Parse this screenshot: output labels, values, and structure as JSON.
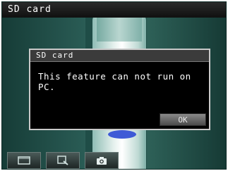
{
  "app": {
    "title": "SD card"
  },
  "dialog": {
    "title": "SD card",
    "message": "This feature can not run on\nPC.",
    "ok_label": "OK"
  },
  "toolbar": {
    "buttons": [
      {
        "icon": "frame-icon"
      },
      {
        "icon": "zoom-icon"
      },
      {
        "icon": "camera-icon"
      }
    ]
  },
  "colors": {
    "background": "#1f4d47",
    "dialog_bg": "#000000",
    "dialog_border": "#c9c9c9",
    "cap_blue": "#3e5ad6"
  }
}
